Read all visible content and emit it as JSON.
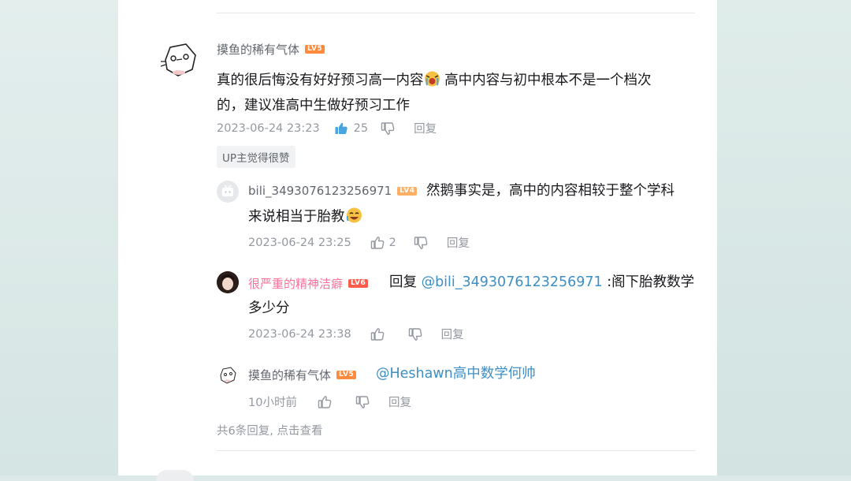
{
  "colors": {
    "accent": "#fb7299",
    "link": "#3d8fc5",
    "like_active": "#4aa4df",
    "text": "#18191c",
    "meta": "#9499a0"
  },
  "main_comment": {
    "username": "摸鱼的稀有气体",
    "level": "LV5",
    "content_line1": "真的很后悔没有好好预习高一内容",
    "emoji": "crying-emoji",
    "content_line1b": " 高中内容与初中根本不是一个档次",
    "content_line2": "的，建议准高中生做好预习工作",
    "time": "2023-06-24 23:23",
    "likes": "25",
    "reply_label": "回复",
    "up_tag": "UP主觉得很赞"
  },
  "replies": [
    {
      "username": "bili_3493076123256971",
      "level": "LV4",
      "content_line1": "然鹅事实是，高中的内容相较于整个学科",
      "content_line2": "来说相当于胎教",
      "emoji": "laughing-emoji",
      "time": "2023-06-24 23:25",
      "likes": "2",
      "reply_label": "回复"
    },
    {
      "username": "很严重的精神洁癖",
      "level": "LV6",
      "prefix": "回复 ",
      "mention": "@bili_3493076123256971",
      "content_line1": " :阁下胎教数学",
      "content_line2": "多少分",
      "time": "2023-06-24 23:38",
      "reply_label": "回复"
    },
    {
      "username": "摸鱼的稀有气体",
      "level": "LV5",
      "mention": "@Heshawn高中数学何帅",
      "time": "10小时前",
      "reply_label": "回复"
    }
  ],
  "view_more": "共6条回复, 点击查看"
}
